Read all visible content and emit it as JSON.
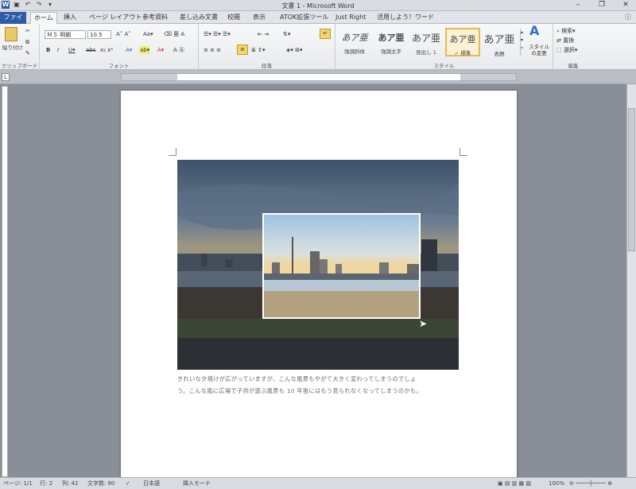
{
  "window": {
    "title": "文書 1 - Microsoft Word"
  },
  "tabs": [
    "ファイル",
    "ホーム",
    "挿入",
    "ページ レイアウト",
    "参考資料",
    "差し込み文書",
    "校閲",
    "表示",
    "ATOK拡張ツール",
    "Just Right",
    "活用しよう！ワード"
  ],
  "ribbon": {
    "clipboard": {
      "label": "クリップボード",
      "paste": "貼り付け"
    },
    "font": {
      "label": "フォント",
      "name": "ＭＳ 明朝",
      "size": "10.5"
    },
    "paragraph": {
      "label": "段落"
    },
    "styles": {
      "label": "スタイル",
      "items": [
        {
          "glyph": "あア亜",
          "name": "強調斜体"
        },
        {
          "glyph": "あア亜",
          "name": "強調太字"
        },
        {
          "glyph": "あア亜",
          "name": "見出し 1"
        },
        {
          "glyph": "あア亜",
          "name": "✓ 標準"
        },
        {
          "glyph": "あア亜",
          "name": "表題"
        }
      ],
      "change": "スタイルの変更"
    },
    "editing": {
      "label": "編集",
      "find": "検索",
      "replace": "置換",
      "select": "選択"
    }
  },
  "document": {
    "line1": "きれいな夕焼けが広がっていますが、こんな風景もやがて大きく変わってしまうのでしょ",
    "line2": "う。こんな風に広場で子供が遊ぶ風景も 10 年後にはもう見られなくなってしまうのかも。"
  },
  "status": {
    "page": "ページ: 1/1",
    "row": "行: 2",
    "col": "列: 42",
    "words": "文字数: 80",
    "lang": "日本語",
    "mode": "挿入モード",
    "zoom": "100%"
  },
  "colors": {
    "accent": "#2c5ba8",
    "selected_style": "#e9b94e"
  }
}
